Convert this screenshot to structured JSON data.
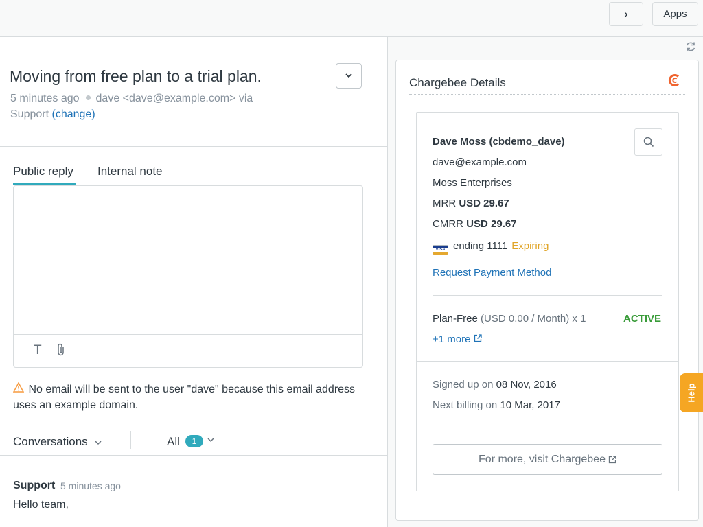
{
  "topbar": {
    "next_label": "›",
    "apps_label": "Apps"
  },
  "ticket": {
    "subject": "Moving from free plan to a trial plan.",
    "time": "5 minutes ago",
    "requester": "dave <dave@example.com> via",
    "channel": "Support",
    "change_link": "(change)",
    "tabs": {
      "public": "Public reply",
      "internal": "Internal note"
    },
    "reply_value": "",
    "toolbar": {
      "format": "T",
      "attach": "📎"
    },
    "warning": "No email will be sent to the user \"dave\" because this email address uses an example domain.",
    "conversations_label": "Conversations",
    "filter_label": "All",
    "filter_count": "1",
    "message": {
      "author": "Support",
      "time": "5 minutes ago",
      "body": "Hello team,"
    }
  },
  "app": {
    "title": "Chargebee Details",
    "customer": {
      "name": "Dave Moss (cbdemo_dave)",
      "email": "dave@example.com",
      "company": "Moss Enterprises",
      "mrr_label": "MRR",
      "mrr_value": "USD 29.67",
      "cmrr_label": "CMRR",
      "cmrr_value": "USD 29.67",
      "card_brand": "VISA",
      "card_text": "ending 1111",
      "card_status": "Expiring",
      "request_link": "Request Payment Method"
    },
    "subscription": {
      "plan": "Plan-Free",
      "plan_detail": "(USD 0.00 / Month) x 1",
      "status": "ACTIVE",
      "more_link": "+1 more"
    },
    "dates": {
      "signed_label": "Signed up on",
      "signed_value": "08 Nov, 2016",
      "billing_label": "Next billing on",
      "billing_value": "10 Mar, 2017"
    },
    "visit_label": "For more, visit Chargebee"
  },
  "help_label": "Help",
  "colors": {
    "accent": "#30aabc",
    "link": "#1f73b7",
    "active": "#3a9c3a",
    "expiring": "#e0a426",
    "brand": "#f0642f",
    "help": "#f5a623"
  }
}
